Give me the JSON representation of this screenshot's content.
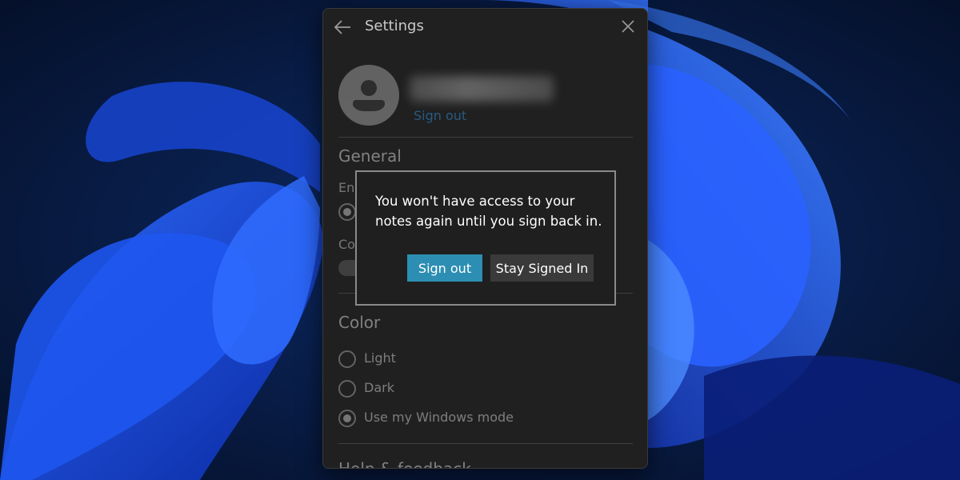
{
  "window": {
    "title": "Settings",
    "account": {
      "sign_out_link": "Sign out"
    },
    "general": {
      "heading": "General",
      "row1_label_partial": "Ena",
      "row2_label_partial": "Co"
    },
    "color": {
      "heading": "Color",
      "options": [
        {
          "label": "Light",
          "checked": false
        },
        {
          "label": "Dark",
          "checked": false
        },
        {
          "label": "Use my Windows mode",
          "checked": true
        }
      ]
    },
    "next_section_partial": "Help & feedback"
  },
  "dialog": {
    "message": "You won't have access to your notes again until you sign back in.",
    "primary_button": "Sign out",
    "secondary_button": "Stay Signed In"
  },
  "colors": {
    "accent_button": "#2d8eb3",
    "link": "#2e8bd0",
    "window_bg": "#202020"
  }
}
